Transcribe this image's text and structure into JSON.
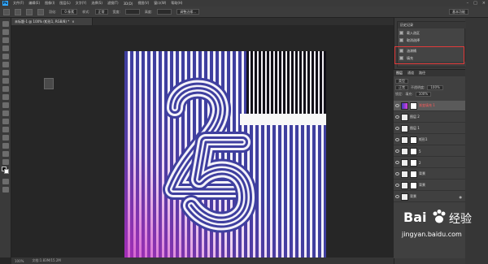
{
  "app": {
    "logo": "Ps",
    "menus": [
      "文件(F)",
      "编辑(E)",
      "图像(I)",
      "图层(L)",
      "文字(Y)",
      "选择(S)",
      "滤镜(T)",
      "3D(D)",
      "视图(V)",
      "窗口(W)",
      "帮助(H)"
    ],
    "window_buttons": [
      "–",
      "□",
      "×"
    ]
  },
  "options_bar": {
    "feather_label": "羽化:",
    "feather_value": "0 像素",
    "style_label": "样式:",
    "style_value": "正常",
    "width_label": "宽度:",
    "height_label": "高度:",
    "refine_button": "调整边缘...",
    "workspace": "基本功能"
  },
  "document": {
    "tab_title": "未标题-1 @ 100% (矩形1, RGB/8) *",
    "zoom": "100%",
    "doc_size": "文档:1.83M/15.2M"
  },
  "history_panel": {
    "title": "历史记录",
    "items": [
      "载入选区",
      "取消选择",
      "油漆桶",
      "填充"
    ]
  },
  "layers_panel": {
    "tabs": [
      "图层",
      "通道",
      "路径"
    ],
    "kind_filter": "类型",
    "blend_mode": "正常",
    "opacity_label": "不透明度:",
    "opacity_value": "100%",
    "lock_label": "锁定:",
    "fill_label": "填充:",
    "fill_value": "100%",
    "layers": [
      {
        "name": "渐变填充 1",
        "selected": true,
        "kind": "gradient"
      },
      {
        "name": "图层 2",
        "selected": false,
        "kind": "normal"
      },
      {
        "name": "图层 1",
        "selected": false,
        "kind": "normal"
      },
      {
        "name": "矩形1",
        "selected": false,
        "kind": "shape"
      },
      {
        "name": "5",
        "selected": false,
        "kind": "shape"
      },
      {
        "name": "2",
        "selected": false,
        "kind": "shape"
      },
      {
        "name": "背景",
        "selected": false,
        "kind": "shape"
      },
      {
        "name": "背景",
        "selected": false,
        "kind": "shape"
      },
      {
        "name": "背景",
        "selected": false,
        "kind": "background"
      }
    ]
  },
  "watermark": {
    "brand": "Bai",
    "brand_cn": "经验",
    "url": "jingyan.baidu.com"
  },
  "colors": {
    "stripe_blue": "#3f3f9f",
    "stripe_white": "#f4f2fa",
    "accent_magenta": "#d040d0",
    "highlight_red": "#e23b3b"
  }
}
